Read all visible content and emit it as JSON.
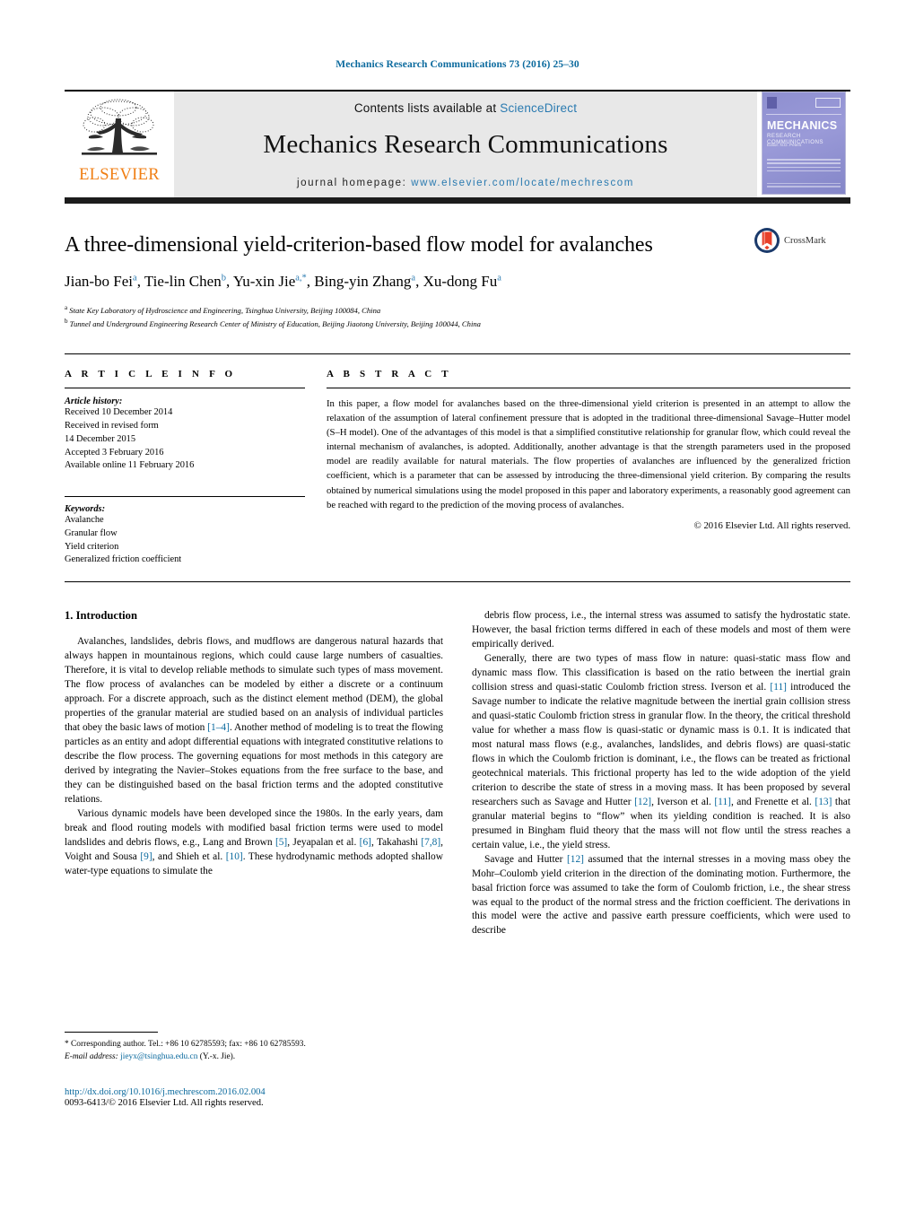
{
  "running_head": "Mechanics Research Communications 73 (2016) 25–30",
  "masthead": {
    "publisher_name": "ELSEVIER",
    "contents_prefix": "Contents lists available at ",
    "contents_link": "ScienceDirect",
    "journal_title": "Mechanics Research Communications",
    "homepage_prefix": "journal homepage:",
    "homepage_url": "www.elsevier.com/locate/mechrescom",
    "cover": {
      "title": "MECHANICS",
      "subtitle": "RESEARCH COMMUNICATIONS",
      "editor": "Editor: N.D. Peters"
    }
  },
  "article": {
    "title": "A three-dimensional yield-criterion-based flow model for avalanches",
    "crossmark_label": "CrossMark",
    "authors_html": "Jian-bo Fei<sup>a</sup>, Tie-lin Chen<sup>b</sup>, Yu-xin Jie<sup>a,*</sup>, Bing-yin Zhang<sup>a</sup>, Xu-dong Fu<sup>a</sup>",
    "affiliations": [
      {
        "marker": "a",
        "text": "State Key Laboratory of Hydroscience and Engineering, Tsinghua University, Beijing 100084, China"
      },
      {
        "marker": "b",
        "text": "Tunnel and Underground Engineering Research Center of Ministry of Education, Beijing Jiaotong University, Beijing 100044, China"
      }
    ]
  },
  "info": {
    "heading": "A R T I C L E   I N F O",
    "history_label": "Article history:",
    "history_lines": [
      "Received 10 December 2014",
      "Received in revised form",
      "14 December 2015",
      "Accepted 3 February 2016",
      "Available online 11 February 2016"
    ],
    "keywords_label": "Keywords:",
    "keywords": [
      "Avalanche",
      "Granular flow",
      "Yield criterion",
      "Generalized friction coefficient"
    ]
  },
  "abstract": {
    "heading": "A B S T R A C T",
    "text": "In this paper, a flow model for avalanches based on the three-dimensional yield criterion is presented in an attempt to allow the relaxation of the assumption of lateral confinement pressure that is adopted in the traditional three-dimensional Savage–Hutter model (S–H model). One of the advantages of this model is that a simplified constitutive relationship for granular flow, which could reveal the internal mechanism of avalanches, is adopted. Additionally, another advantage is that the strength parameters used in the proposed model are readily available for natural materials. The flow properties of avalanches are influenced by the generalized friction coefficient, which is a parameter that can be assessed by introducing the three-dimensional yield criterion. By comparing the results obtained by numerical simulations using the model proposed in this paper and laboratory experiments, a reasonably good agreement can be reached with regard to the prediction of the moving process of avalanches.",
    "copyright": "© 2016 Elsevier Ltd. All rights reserved."
  },
  "body": {
    "section_heading": "1.  Introduction",
    "left_paragraphs": [
      "Avalanches, landslides, debris flows, and mudflows are dangerous natural hazards that always happen in mountainous regions, which could cause large numbers of casualties. Therefore, it is vital to develop reliable methods to simulate such types of mass movement. The flow process of avalanches can be modeled by either a discrete or a continuum approach. For a discrete approach, such as the distinct element method (DEM), the global properties of the granular material are studied based on an analysis of individual particles that obey the basic laws of motion [1–4]. Another method of modeling is to treat the flowing particles as an entity and adopt differential equations with integrated constitutive relations to describe the flow process. The governing equations for most methods in this category are derived by integrating the Navier–Stokes equations from the free surface to the base, and they can be distinguished based on the basal friction terms and the adopted constitutive relations.",
      "Various dynamic models have been developed since the 1980s. In the early years, dam break and flood routing models with modified basal friction terms were used to model landslides and debris flows, e.g., Lang and Brown [5], Jeyapalan et al. [6], Takahashi [7,8], Voight and Sousa [9], and Shieh et al. [10]. These hydrodynamic methods adopted shallow water-type equations to simulate the"
    ],
    "right_paragraphs": [
      "debris flow process, i.e., the internal stress was assumed to satisfy the hydrostatic state. However, the basal friction terms differed in each of these models and most of them were empirically derived.",
      "Generally, there are two types of mass flow in nature: quasi-static mass flow and dynamic mass flow. This classification is based on the ratio between the inertial grain collision stress and quasi-static Coulomb friction stress. Iverson et al. [11] introduced the Savage number to indicate the relative magnitude between the inertial grain collision stress and quasi-static Coulomb friction stress in granular flow. In the theory, the critical threshold value for whether a mass flow is quasi-static or dynamic mass is 0.1. It is indicated that most natural mass flows (e.g., avalanches, landslides, and debris flows) are quasi-static flows in which the Coulomb friction is dominant, i.e., the flows can be treated as frictional geotechnical materials. This frictional property has led to the wide adoption of the yield criterion to describe the state of stress in a moving mass. It has been proposed by several researchers such as Savage and Hutter [12], Iverson et al. [11], and Frenette et al. [13] that granular material begins to “flow” when its yielding condition is reached. It is also presumed in Bingham fluid theory that the mass will not flow until the stress reaches a certain value, i.e., the yield stress.",
      "Savage and Hutter [12] assumed that the internal stresses in a moving mass obey the Mohr–Coulomb yield criterion in the direction of the dominating motion. Furthermore, the basal friction force was assumed to take the form of Coulomb friction, i.e., the shear stress was equal to the product of the normal stress and the friction coefficient. The derivations in this model were the active and passive earth pressure coefficients, which were used to describe"
    ]
  },
  "footnote": {
    "corresponding": "* Corresponding author. Tel.: +86 10 62785593; fax: +86 10 62785593.",
    "email_label": "E-mail address:",
    "email": "jieyx@tsinghua.edu.cn",
    "email_suffix": "(Y.-x. Jie)."
  },
  "footer": {
    "doi": "http://dx.doi.org/10.1016/j.mechrescom.2016.02.004",
    "issn_line": "0093-6413/© 2016 Elsevier Ltd. All rights reserved."
  },
  "colors": {
    "link_blue": "#0b6a9e",
    "elsevier_orange": "#f07e13",
    "cover_purple": "#8e8fd0"
  }
}
